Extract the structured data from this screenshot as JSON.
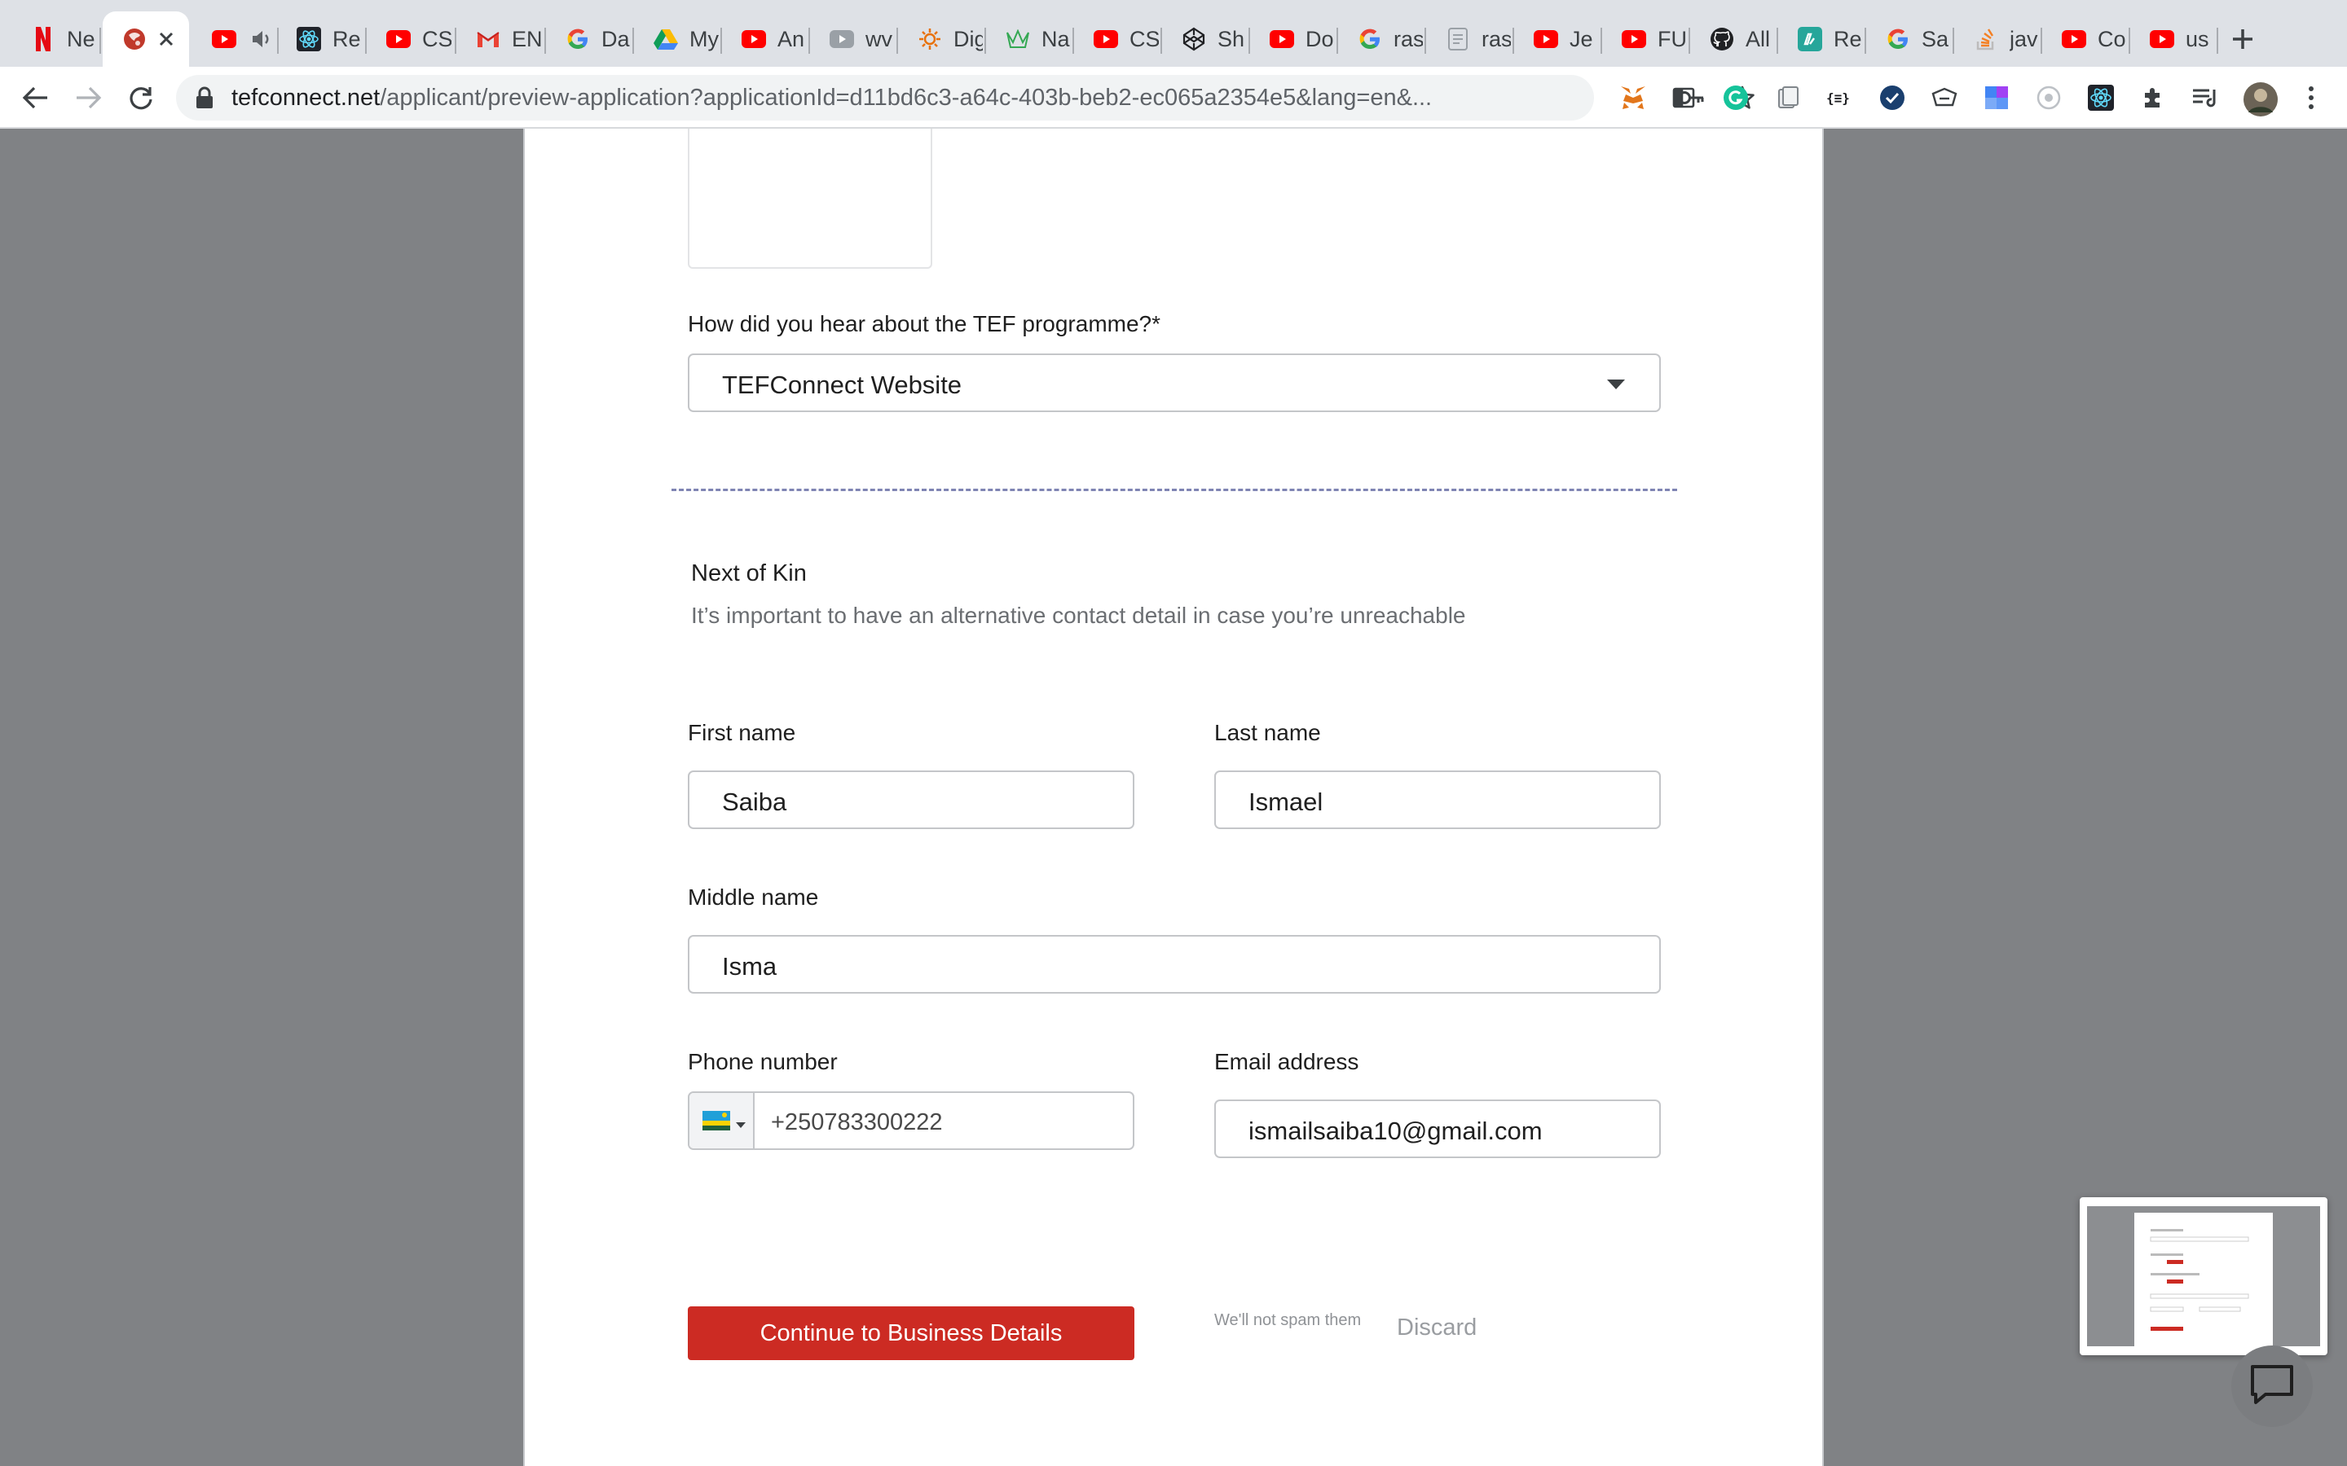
{
  "browser": {
    "tabs": [
      {
        "title": "Ne",
        "icon": "netflix-icon"
      },
      {
        "title": "",
        "icon": "tefconnect-icon",
        "active": true
      },
      {
        "title": "",
        "icon": "youtube-icon",
        "audio": true
      },
      {
        "title": "Re",
        "icon": "react-icon"
      },
      {
        "title": "CS",
        "icon": "youtube-icon"
      },
      {
        "title": "EN",
        "icon": "gmail-icon"
      },
      {
        "title": "Da",
        "icon": "google-icon"
      },
      {
        "title": "My",
        "icon": "google-drive-icon"
      },
      {
        "title": "An",
        "icon": "youtube-icon"
      },
      {
        "title": "wv",
        "icon": "video-icon"
      },
      {
        "title": "Dig",
        "icon": "sun-icon"
      },
      {
        "title": "Na",
        "icon": "crown-icon"
      },
      {
        "title": "CS",
        "icon": "youtube-icon"
      },
      {
        "title": "Sh",
        "icon": "codepen-icon"
      },
      {
        "title": "Do",
        "icon": "youtube-icon"
      },
      {
        "title": "ras",
        "icon": "google-icon"
      },
      {
        "title": "ras",
        "icon": "document-icon"
      },
      {
        "title": "Je",
        "icon": "youtube-icon"
      },
      {
        "title": "FU",
        "icon": "youtube-icon"
      },
      {
        "title": "All",
        "icon": "github-icon"
      },
      {
        "title": "Re",
        "icon": "app-icon"
      },
      {
        "title": "Sa",
        "icon": "google-icon"
      },
      {
        "title": "jav",
        "icon": "stackoverflow-icon"
      },
      {
        "title": "Co",
        "icon": "youtube-icon"
      },
      {
        "title": "us",
        "icon": "youtube-icon"
      }
    ],
    "url_host": "tefconnect.net",
    "url_rest": "/applicant/preview-application?applicationId=d11bd6c3-a64c-403b-beb2-ec065a2354e5&lang=en&..."
  },
  "form": {
    "referral_label": "How did you hear about the TEF programme?*",
    "referral_value": "TEFConnect Website",
    "section_title": "Next of Kin",
    "section_subtitle": "It’s important to have an alternative contact detail in case you’re unreachable",
    "first_name_label": "First name",
    "first_name_value": "Saiba",
    "last_name_label": "Last name",
    "last_name_value": "Ismael",
    "middle_name_label": "Middle name",
    "middle_name_value": "Isma",
    "phone_label": "Phone number",
    "phone_value": "+250783300222",
    "email_label": "Email address",
    "email_value": "ismailsaiba10@gmail.com",
    "email_hint": "We'll not spam them",
    "continue_label": "Continue to Business Details",
    "discard_label": "Discard"
  },
  "colors": {
    "primary_button": "#cc2b23",
    "divider": "#7f84b3",
    "page_background": "#808285"
  }
}
